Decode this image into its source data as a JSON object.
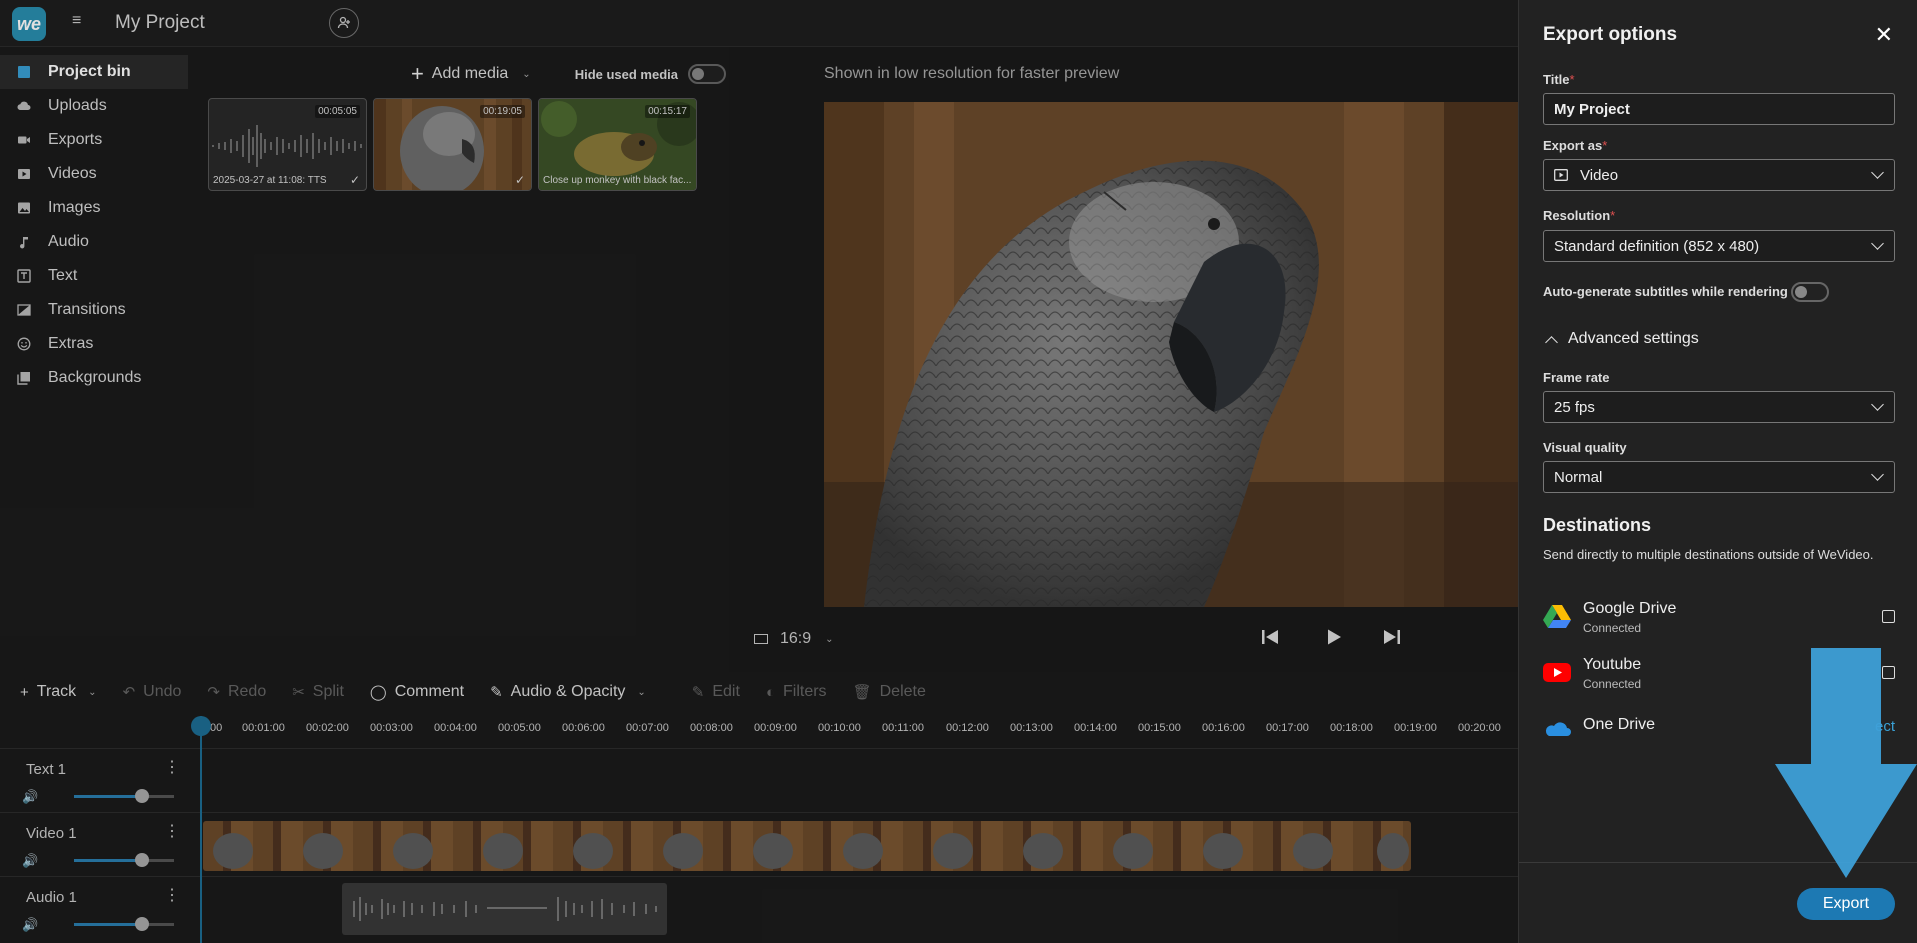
{
  "app": {
    "logo": "we",
    "project_title": "My Project"
  },
  "sidebar": {
    "items": [
      {
        "label": "Project bin",
        "icon": "square-icon"
      },
      {
        "label": "Uploads",
        "icon": "cloud-upload-icon"
      },
      {
        "label": "Exports",
        "icon": "video-camera-icon"
      },
      {
        "label": "Videos",
        "icon": "play-box-icon"
      },
      {
        "label": "Images",
        "icon": "image-icon"
      },
      {
        "label": "Audio",
        "icon": "music-note-icon"
      },
      {
        "label": "Text",
        "icon": "text-box-icon"
      },
      {
        "label": "Transitions",
        "icon": "transition-icon"
      },
      {
        "label": "Extras",
        "icon": "smiley-icon"
      },
      {
        "label": "Backgrounds",
        "icon": "layers-icon"
      }
    ]
  },
  "bin": {
    "add_media": "Add media",
    "hide_used": "Hide used media",
    "items": [
      {
        "duration": "00:05:05",
        "caption": "2025-03-27 at 11:08: TTS",
        "used": true,
        "kind": "audio"
      },
      {
        "duration": "00:19:05",
        "caption": "",
        "used": true,
        "kind": "parrot"
      },
      {
        "duration": "00:15:17",
        "caption": "Close up monkey with black fac...",
        "used": false,
        "kind": "monkey"
      }
    ]
  },
  "preview": {
    "note": "Shown in low resolution for faster preview",
    "ratio": "16:9"
  },
  "toolbar": {
    "track": "Track",
    "undo": "Undo",
    "redo": "Redo",
    "split": "Split",
    "comment": "Comment",
    "audio_opacity": "Audio & Opacity",
    "edit": "Edit",
    "filters": "Filters",
    "delete": "Delete"
  },
  "ruler": [
    "00",
    "00:01:00",
    "00:02:00",
    "00:03:00",
    "00:04:00",
    "00:05:00",
    "00:06:00",
    "00:07:00",
    "00:08:00",
    "00:09:00",
    "00:10:00",
    "00:11:00",
    "00:12:00",
    "00:13:00",
    "00:14:00",
    "00:15:00",
    "00:16:00",
    "00:17:00",
    "00:18:00",
    "00:19:00",
    "00:20:00"
  ],
  "tracks": [
    {
      "name": "Text 1",
      "volume": 0.68
    },
    {
      "name": "Video 1",
      "volume": 0.68
    },
    {
      "name": "Audio 1",
      "volume": 0.68
    }
  ],
  "export": {
    "title": "Export options",
    "title_label": "Title",
    "title_value": "My Project",
    "export_as_label": "Export as",
    "export_as_value": "Video",
    "resolution_label": "Resolution",
    "resolution_value": "Standard definition (852 x 480)",
    "autosub": "Auto-generate subtitles while rendering",
    "advanced": "Advanced settings",
    "frame_rate_label": "Frame rate",
    "frame_rate_value": "25 fps",
    "quality_label": "Visual quality",
    "quality_value": "Normal",
    "destinations_heading": "Destinations",
    "destinations_sub": "Send directly to multiple destinations outside of WeVideo.",
    "destinations": [
      {
        "name": "Google Drive",
        "status": "Connected"
      },
      {
        "name": "Youtube",
        "status": "Connected"
      },
      {
        "name": "One Drive",
        "action": "ect"
      }
    ],
    "export_button": "Export",
    "accent": "#1d79b3"
  }
}
